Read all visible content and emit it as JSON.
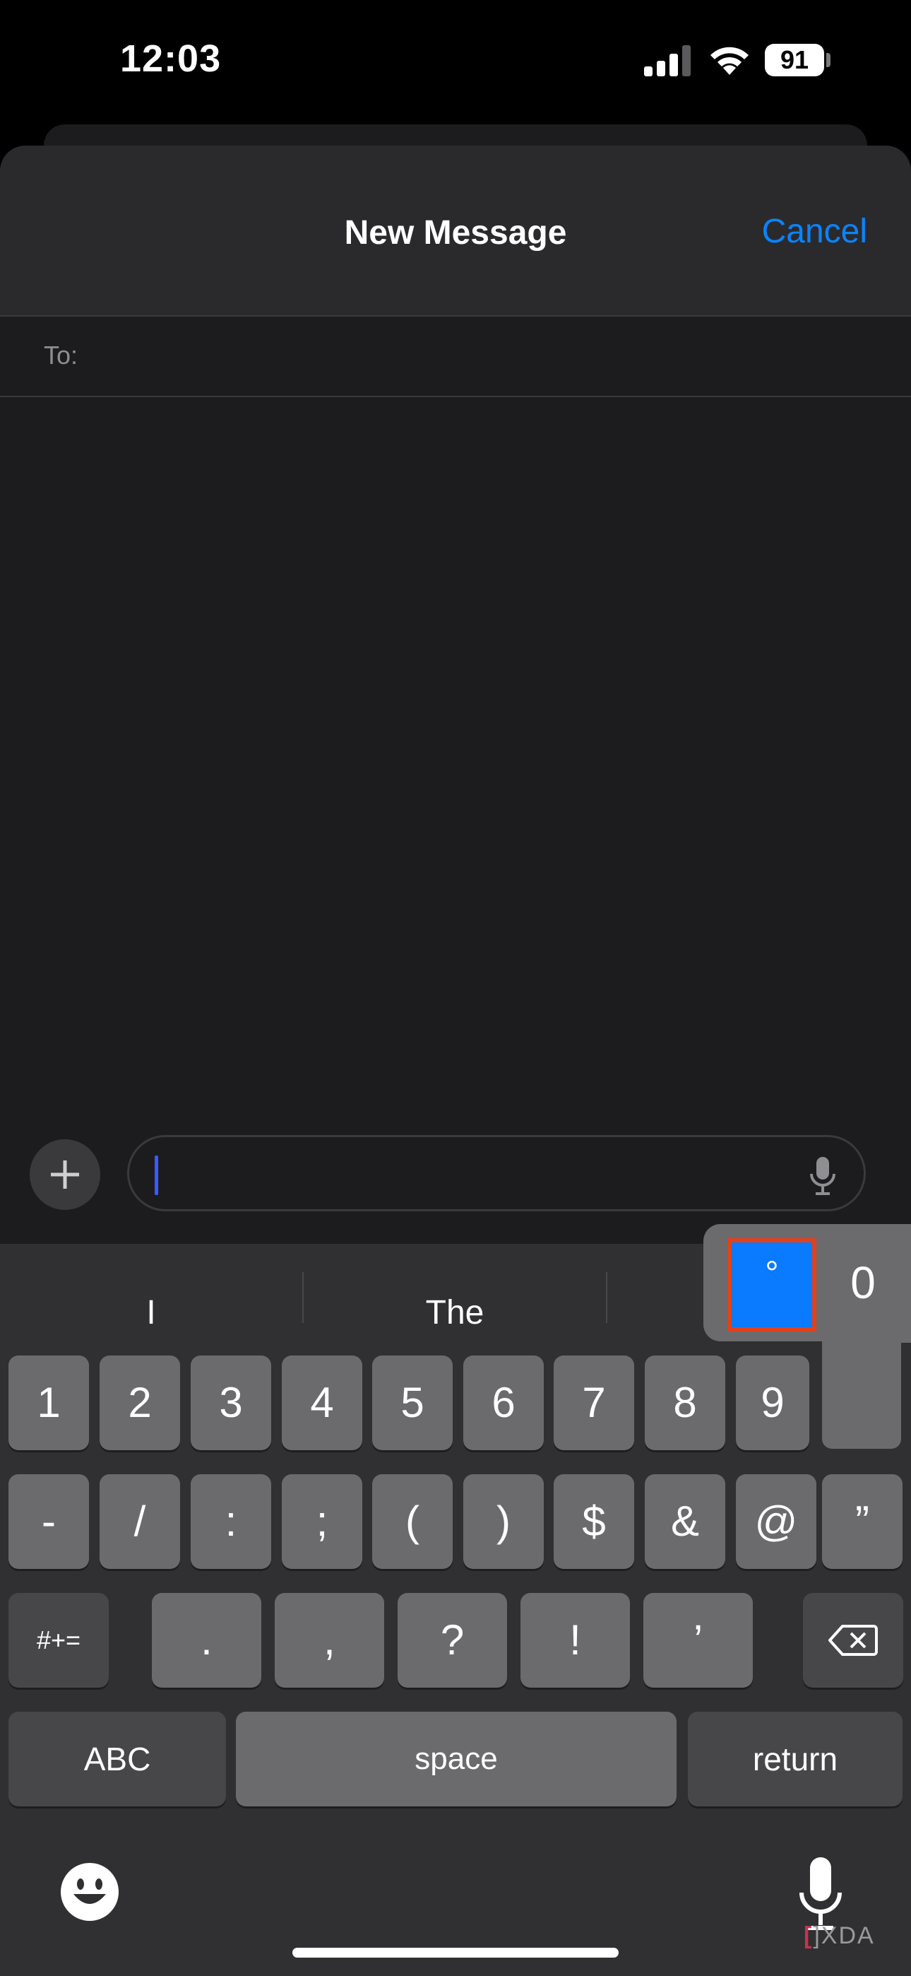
{
  "status_bar": {
    "time": "12:03",
    "battery": "91"
  },
  "nav": {
    "title": "New Message",
    "cancel_label": "Cancel"
  },
  "recipient": {
    "label": "To:"
  },
  "compose": {
    "value": ""
  },
  "predictions": [
    "I",
    "The"
  ],
  "popup": {
    "options": [
      "°",
      "0"
    ],
    "selected": "°"
  },
  "keyboard": {
    "row1": [
      "1",
      "2",
      "3",
      "4",
      "5",
      "6",
      "7",
      "8",
      "9"
    ],
    "row2": [
      "-",
      "/",
      ":",
      ";",
      "(",
      ")",
      "$",
      "&",
      "@",
      "”"
    ],
    "row3": [
      "#+=",
      ".",
      ",",
      "?",
      "!",
      "’"
    ],
    "row4": [
      "ABC",
      "space",
      "return"
    ]
  },
  "watermark": {
    "bracket": "[",
    "text": "]XDA"
  },
  "colors": {
    "accent": "#0a84ff",
    "highlight": "#0a7aff",
    "annotation": "#e1411b"
  }
}
